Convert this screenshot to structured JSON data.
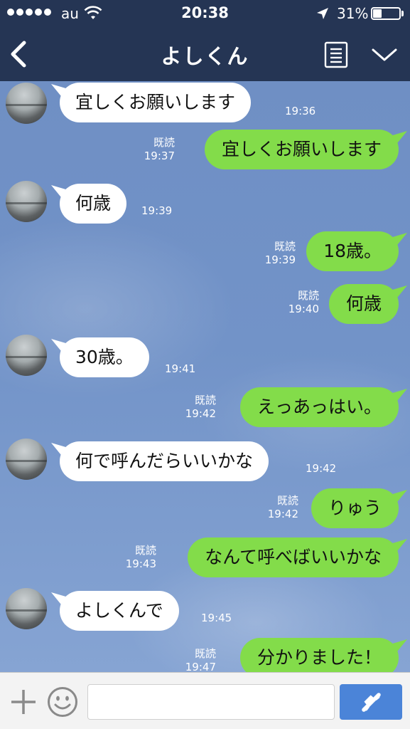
{
  "status_bar": {
    "carrier": "au",
    "time": "20:38",
    "battery_percent": "31%",
    "battery_level": 0.31,
    "signal_bars": 5
  },
  "header": {
    "title": "よしくん",
    "back_icon": "chevron-left-icon",
    "memo_icon": "note-icon",
    "menu_icon": "chevron-down-icon"
  },
  "messages": [
    {
      "dir": "in",
      "text": "宜しくお願いします",
      "time": "19:36"
    },
    {
      "dir": "out",
      "text": "宜しくお願いします",
      "time": "19:37",
      "read": "既読"
    },
    {
      "dir": "in",
      "text": "何歳",
      "time": "19:39"
    },
    {
      "dir": "out",
      "text": "18歳。",
      "time": "19:39",
      "read": "既読"
    },
    {
      "dir": "out",
      "text": "何歳",
      "time": "19:40",
      "read": "既読"
    },
    {
      "dir": "in",
      "text": "30歳。",
      "time": "19:41"
    },
    {
      "dir": "out",
      "text": "えっあっはい。",
      "time": "19:42",
      "read": "既読"
    },
    {
      "dir": "in",
      "text": "何で呼んだらいいかな",
      "time": "19:42"
    },
    {
      "dir": "out",
      "text": "りゅう",
      "time": "19:42",
      "read": "既読"
    },
    {
      "dir": "out",
      "text": "なんて呼べばいいかな",
      "time": "19:43",
      "read": "既読"
    },
    {
      "dir": "in",
      "text": "よしくんで",
      "time": "19:45"
    },
    {
      "dir": "out",
      "text": "分かりました！",
      "time": "19:47",
      "read": "既読"
    }
  ],
  "composer": {
    "placeholder": "",
    "plus_icon": "plus-icon",
    "sticker_icon": "smiley-icon",
    "call_icon": "phone-icon"
  },
  "colors": {
    "header_bg": "#253554",
    "outgoing_bubble": "#83dc4a",
    "incoming_bubble": "#ffffff",
    "call_button": "#4b84d8"
  }
}
